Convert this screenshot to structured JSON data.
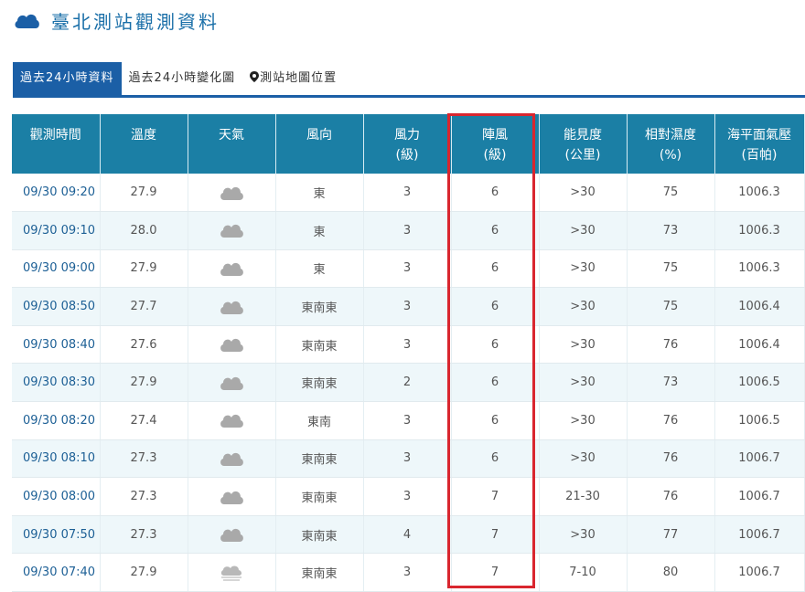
{
  "header": {
    "title": "臺北測站觀測資料",
    "icon": "cloud-icon"
  },
  "tabs": [
    {
      "label": "過去24小時資料",
      "active": true
    },
    {
      "label": "過去24小時變化圖",
      "active": false
    },
    {
      "label": "測站地圖位置",
      "active": false,
      "icon": "map-pin-icon"
    }
  ],
  "table": {
    "headers": [
      "觀測時間",
      "溫度",
      "天氣",
      "風向",
      "風力\n(級)",
      "陣風\n(級)",
      "能見度\n(公里)",
      "相對濕度\n(%)",
      "海平面氣壓\n(百帕)"
    ],
    "rows": [
      {
        "time": "09/30 09:20",
        "temp": "27.9",
        "weather": "cloudy-icon",
        "dir": "東",
        "force": "3",
        "gust": "6",
        "vis": ">30",
        "hum": "75",
        "pres": "1006.3"
      },
      {
        "time": "09/30 09:10",
        "temp": "28.0",
        "weather": "cloudy-icon",
        "dir": "東",
        "force": "3",
        "gust": "6",
        "vis": ">30",
        "hum": "73",
        "pres": "1006.3"
      },
      {
        "time": "09/30 09:00",
        "temp": "27.9",
        "weather": "cloudy-icon",
        "dir": "東",
        "force": "3",
        "gust": "6",
        "vis": ">30",
        "hum": "75",
        "pres": "1006.3"
      },
      {
        "time": "09/30 08:50",
        "temp": "27.7",
        "weather": "cloudy-icon",
        "dir": "東南東",
        "force": "3",
        "gust": "6",
        "vis": ">30",
        "hum": "75",
        "pres": "1006.4"
      },
      {
        "time": "09/30 08:40",
        "temp": "27.6",
        "weather": "cloudy-icon",
        "dir": "東南東",
        "force": "3",
        "gust": "6",
        "vis": ">30",
        "hum": "76",
        "pres": "1006.4"
      },
      {
        "time": "09/30 08:30",
        "temp": "27.9",
        "weather": "cloudy-icon",
        "dir": "東南東",
        "force": "2",
        "gust": "6",
        "vis": ">30",
        "hum": "73",
        "pres": "1006.5"
      },
      {
        "time": "09/30 08:20",
        "temp": "27.4",
        "weather": "cloudy-icon",
        "dir": "東南",
        "force": "3",
        "gust": "6",
        "vis": ">30",
        "hum": "76",
        "pres": "1006.5"
      },
      {
        "time": "09/30 08:10",
        "temp": "27.3",
        "weather": "cloudy-icon",
        "dir": "東南東",
        "force": "3",
        "gust": "6",
        "vis": ">30",
        "hum": "76",
        "pres": "1006.7"
      },
      {
        "time": "09/30 08:00",
        "temp": "27.3",
        "weather": "cloudy-icon",
        "dir": "東南東",
        "force": "3",
        "gust": "7",
        "vis": "21-30",
        "hum": "76",
        "pres": "1006.7"
      },
      {
        "time": "09/30 07:50",
        "temp": "27.3",
        "weather": "cloudy-icon",
        "dir": "東南東",
        "force": "4",
        "gust": "7",
        "vis": ">30",
        "hum": "77",
        "pres": "1006.7"
      },
      {
        "time": "09/30 07:40",
        "temp": "27.9",
        "weather": "fog-icon",
        "dir": "東南東",
        "force": "3",
        "gust": "7",
        "vis": "7-10",
        "hum": "80",
        "pres": "1006.7"
      }
    ]
  },
  "colors": {
    "accent": "#1b5fa6",
    "header_bg": "#1b7fa5",
    "highlight": "#d9262f",
    "row_alt": "#eef7fa"
  }
}
